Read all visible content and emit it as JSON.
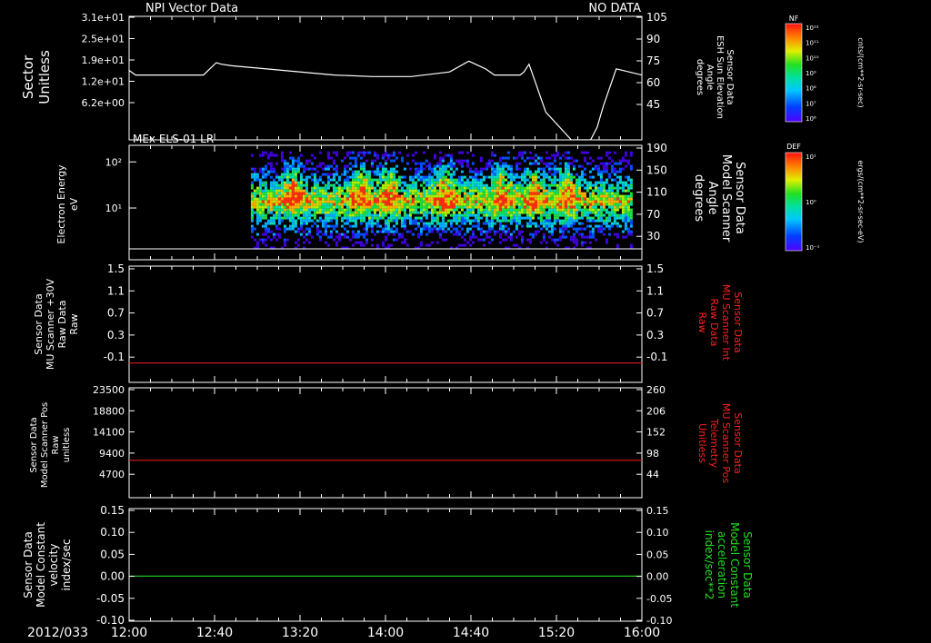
{
  "date_label": "2012/033",
  "time_ticks": [
    "12:00",
    "12:40",
    "13:20",
    "14:00",
    "14:40",
    "15:20",
    "16:00"
  ],
  "chart_data": [
    {
      "id": "p1",
      "type": "line",
      "title": "NPI Vector Data",
      "title_right": "NO DATA",
      "ylabel_left": [
        "Sector",
        "Unitless"
      ],
      "left_ticks": [
        "3.1e+01",
        "2.5e+01",
        "1.9e+01",
        "1.2e+01",
        "6.2e+00"
      ],
      "ylabel_right": [
        "Sensor Data",
        "ESH Sun Elevation",
        "Angle",
        "degrees"
      ],
      "right_ticks": [
        "105",
        "90",
        "75",
        "60",
        "45"
      ],
      "ylim_right": [
        30,
        110
      ],
      "x_hours": [
        12.0,
        12.05,
        12.12,
        12.3,
        12.58,
        12.63,
        12.68,
        12.72,
        12.8,
        13.2,
        13.6,
        13.9,
        14.2,
        14.5,
        14.65,
        14.78,
        14.85,
        14.9,
        14.97,
        15.05,
        15.08,
        15.12,
        15.25,
        15.45,
        15.53,
        15.6,
        15.65,
        15.7,
        15.8,
        16.0
      ],
      "y_values": [
        75,
        72,
        72,
        72,
        72,
        76,
        80,
        79,
        78,
        75,
        72,
        71,
        71,
        74,
        81,
        76,
        72,
        72,
        72,
        72,
        74,
        79,
        48,
        30,
        30,
        30,
        38,
        52,
        76,
        72
      ],
      "line_color": "#ffffff",
      "colorbar": {
        "label": "NF",
        "units": "cnts/(cm**2-sr-sec)",
        "ticks": [
          "10¹²",
          "10¹¹",
          "10¹⁰",
          "10⁹",
          "10⁸",
          "10⁷",
          "10⁶"
        ]
      }
    },
    {
      "id": "p2",
      "type": "heatmap",
      "title": "MEx ELS-01 LR",
      "ylabel_left": [
        "Electron Energy",
        "eV"
      ],
      "left_ticks": [
        "10²",
        "10¹"
      ],
      "ylabel_right": [
        "Sensor Data",
        "Model Scanner",
        "Angle",
        "degrees"
      ],
      "right_ticks": [
        "190",
        "150",
        "110",
        "70",
        "30"
      ],
      "coverage_hours": [
        12.95,
        15.91
      ],
      "energy_range_ev": [
        10,
        100
      ],
      "reference_line_ev": 1.3,
      "enhancements_hours": [
        13.27,
        13.8,
        14.02,
        14.45,
        14.9,
        15.15,
        15.4
      ],
      "colorbar": {
        "label": "DEF",
        "units": "ergs/(cm**2-sr-sec-eV)",
        "ticks": [
          "10¹",
          "10⁰",
          "10⁻¹"
        ]
      }
    },
    {
      "id": "p3",
      "type": "line",
      "ylabel_left": [
        "Sensor Data",
        "MU Scanner +30V",
        "Raw Data",
        "Raw"
      ],
      "left_ticks": [
        "1.5",
        "1.1",
        "0.7",
        "0.3",
        "-0.1"
      ],
      "ylim": [
        -0.3,
        1.5
      ],
      "ylabel_right": [
        "Sensor Data",
        "MU Scanner Int",
        "Raw Data",
        "Raw"
      ],
      "right_ticks": [
        "1.5",
        "1.1",
        "0.7",
        "0.3",
        "-0.1"
      ],
      "ylabel_right_color": "#ff2020",
      "constant_value": 0.0,
      "line_color": "#e01818"
    },
    {
      "id": "p4",
      "type": "line",
      "ylabel_left": [
        "Sensor Data",
        "Model Scanner Pos",
        "Raw",
        "unitless"
      ],
      "left_ticks": [
        "23500",
        "18800",
        "14100",
        "9400",
        "4700"
      ],
      "ylim": [
        0,
        23500
      ],
      "ylabel_right": [
        "Sensor Data",
        "MU Scanner Pos",
        "Telemetry",
        "Unitless"
      ],
      "right_ticks": [
        "260",
        "206",
        "152",
        "98",
        "44"
      ],
      "ylabel_right_color": "#ff2020",
      "constant_value": 8000,
      "line_color": "#e01818"
    },
    {
      "id": "p5",
      "type": "line",
      "ylabel_left": [
        "Sensor Data",
        "Model Constant",
        "velocity",
        "index/sec"
      ],
      "left_ticks": [
        "0.15",
        "0.10",
        "0.05",
        "0.00",
        "-0.05",
        "-0.10"
      ],
      "ylim": [
        -0.1,
        0.15
      ],
      "ylabel_right": [
        "Sensor Data",
        "Model Constant",
        "acceleration",
        "index/sec**2"
      ],
      "right_ticks": [
        "0.15",
        "0.10",
        "0.05",
        "0.00",
        "-0.05",
        "-0.10"
      ],
      "ylabel_right_color": "#20e020",
      "constant_value": 0.0,
      "line_color": "#20c020"
    }
  ]
}
